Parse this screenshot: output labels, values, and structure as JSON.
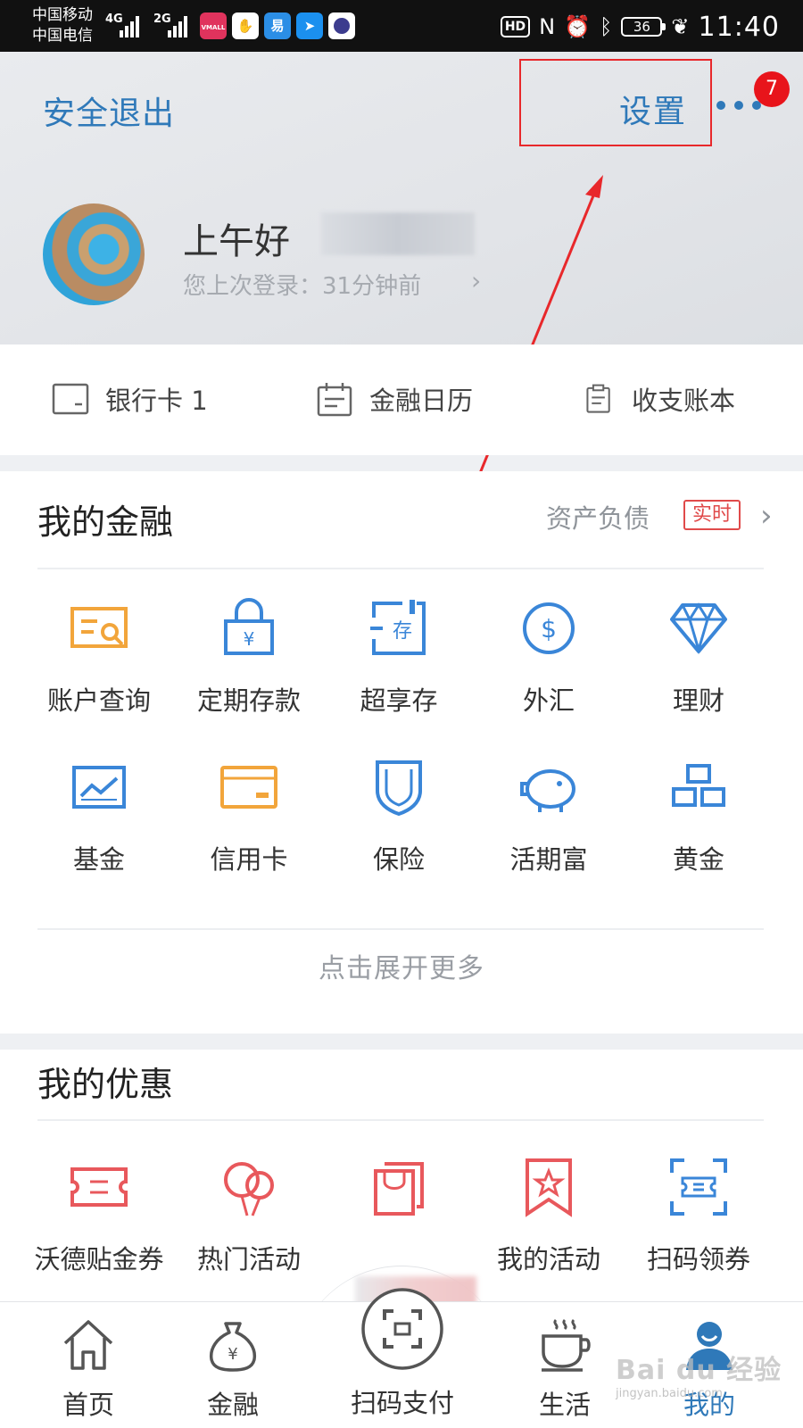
{
  "status_bar": {
    "carrier1": "中国移动",
    "carrier2": "中国电信",
    "net1": "4G",
    "net2": "2G",
    "apps": [
      "VMALL",
      "易"
    ],
    "hd": "HD",
    "nfc": "N",
    "battery": "36",
    "time": "11:40"
  },
  "header": {
    "logout": "安全退出",
    "settings": "设置",
    "badge": "7",
    "greeting": "上午好",
    "last_login": "您上次登录：31分钟前"
  },
  "quick_links": [
    {
      "label": "银行卡  1",
      "icon": "bank-card-icon"
    },
    {
      "label": "金融日历",
      "icon": "calendar-icon"
    },
    {
      "label": "收支账本",
      "icon": "ledger-icon"
    }
  ],
  "finance": {
    "title": "我的金融",
    "assets_link": "资产负债",
    "realtime_tag": "实时",
    "items": [
      {
        "label": "账户查询",
        "icon": "account-query-icon"
      },
      {
        "label": "定期存款",
        "icon": "fixed-deposit-icon"
      },
      {
        "label": "超享存",
        "icon": "super-deposit-icon"
      },
      {
        "label": "外汇",
        "icon": "forex-icon"
      },
      {
        "label": "理财",
        "icon": "wealth-icon"
      },
      {
        "label": "基金",
        "icon": "fund-icon"
      },
      {
        "label": "信用卡",
        "icon": "credit-card-icon"
      },
      {
        "label": "保险",
        "icon": "insurance-icon"
      },
      {
        "label": "活期富",
        "icon": "piggy-bank-icon"
      },
      {
        "label": "黄金",
        "icon": "gold-icon"
      }
    ],
    "expand": "点击展开更多"
  },
  "offers": {
    "title": "我的优惠",
    "items": [
      {
        "label": "沃德贴金券",
        "icon": "coupon-icon"
      },
      {
        "label": "热门活动",
        "icon": "balloon-icon"
      },
      {
        "label": "",
        "icon": "shopping-bag-icon"
      },
      {
        "label": "我的活动",
        "icon": "star-ribbon-icon"
      },
      {
        "label": "扫码领券",
        "icon": "scan-coupon-icon"
      }
    ]
  },
  "nav": {
    "items": [
      {
        "label": "首页",
        "icon": "home-icon"
      },
      {
        "label": "金融",
        "icon": "money-bag-icon"
      },
      {
        "label": "扫码支付",
        "icon": "scan-pay-icon"
      },
      {
        "label": "生活",
        "icon": "coffee-cup-icon"
      },
      {
        "label": "我的",
        "icon": "user-icon"
      }
    ],
    "active_index": 4
  },
  "watermark": {
    "brand": "Bai du 经验",
    "url": "jingyan.baidu.com"
  },
  "colors": {
    "accent_blue": "#2f79b9",
    "icon_blue": "#3a86d8",
    "icon_orange": "#f2a53b",
    "icon_red": "#e8585c",
    "highlight_red": "#e8282b"
  }
}
